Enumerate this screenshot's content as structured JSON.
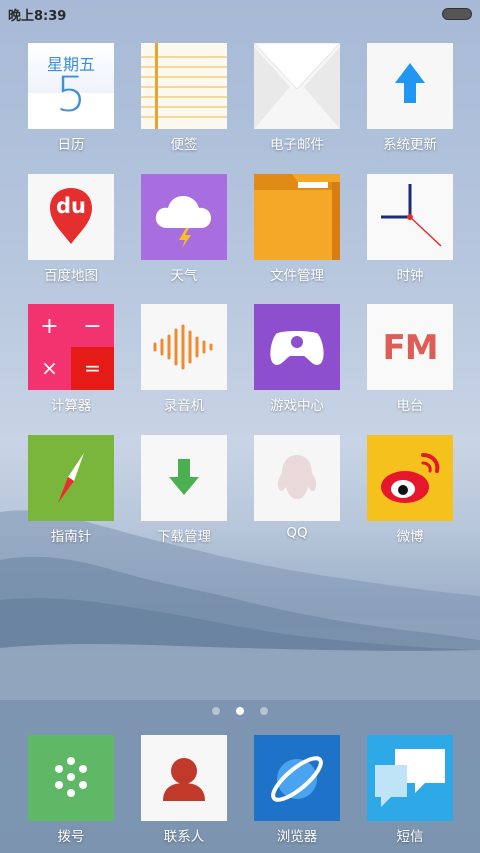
{
  "status_bar": {
    "time": "晚上8:39"
  },
  "apps": [
    {
      "label": "日历",
      "calendar_weekday": "星期五",
      "calendar_day": "5"
    },
    {
      "label": "便签"
    },
    {
      "label": "电子邮件"
    },
    {
      "label": "系统更新"
    },
    {
      "label": "百度地图",
      "tile_text": "du"
    },
    {
      "label": "天气"
    },
    {
      "label": "文件管理"
    },
    {
      "label": "时钟"
    },
    {
      "label": "计算器",
      "keys": [
        "+",
        "−",
        "×",
        "="
      ]
    },
    {
      "label": "录音机"
    },
    {
      "label": "游戏中心"
    },
    {
      "label": "电台",
      "tile_text": "FM"
    },
    {
      "label": "指南针"
    },
    {
      "label": "下载管理"
    },
    {
      "label": "QQ"
    },
    {
      "label": "微博"
    }
  ],
  "dock": [
    {
      "label": "拨号"
    },
    {
      "label": "联系人"
    },
    {
      "label": "浏览器"
    },
    {
      "label": "短信"
    }
  ],
  "page_indicator": {
    "count": 3,
    "active": 2
  }
}
